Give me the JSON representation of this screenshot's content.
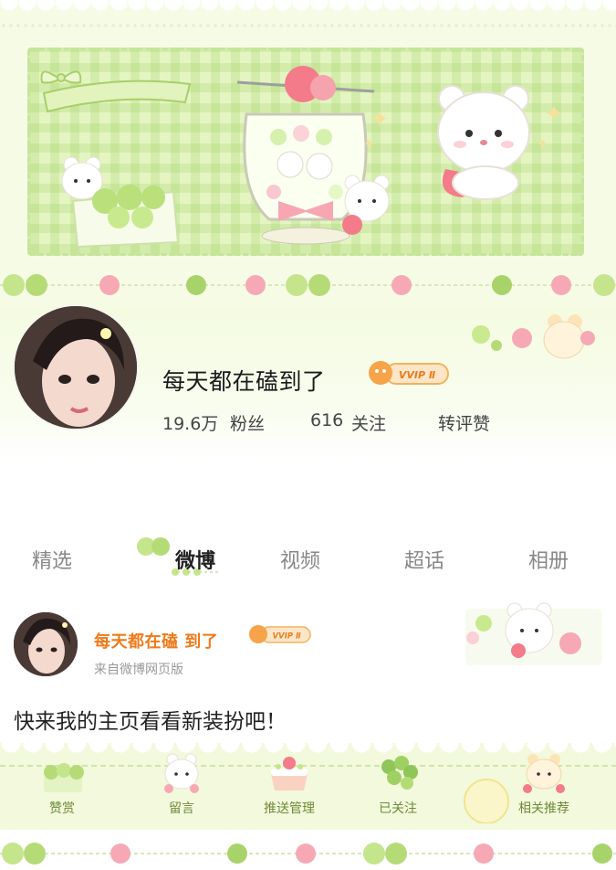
{
  "profile": {
    "username": "每天都在磕到了",
    "vip_label": "VVIP Ⅱ",
    "stats": {
      "followers_value": "19.6万",
      "followers_label": "粉丝",
      "following_value": "616",
      "following_label": "关注",
      "interactions_label": "转评赞"
    }
  },
  "tabs": [
    {
      "label": "精选",
      "active": false
    },
    {
      "label": "微博",
      "active": true
    },
    {
      "label": "视频",
      "active": false
    },
    {
      "label": "超话",
      "active": false
    },
    {
      "label": "相册",
      "active": false
    }
  ],
  "post": {
    "author": "每天都在磕 到了",
    "vip_label": "VVIP Ⅱ",
    "source": "来自微博网页版",
    "text": "快来我的主页看看新装扮吧！"
  },
  "actions": [
    {
      "label": "赞赏",
      "icon": "grape-icon"
    },
    {
      "label": "留言",
      "icon": "bear-message-icon"
    },
    {
      "label": "推送管理",
      "icon": "cake-icon"
    },
    {
      "label": "已关注",
      "icon": "grape-cluster-icon"
    },
    {
      "label": "相关推荐",
      "icon": "bear-recommend-icon"
    }
  ],
  "theme": {
    "accent_green": "#c6e59a",
    "strawberry": "#f37b8a",
    "name_orange": "#f07a1a"
  }
}
